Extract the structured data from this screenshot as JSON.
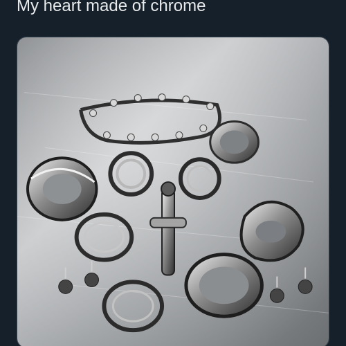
{
  "post": {
    "text": "My heart made of chrome"
  },
  "photo": {
    "subject": "chrome-jewelry-collection",
    "surface": "brushed-steel"
  },
  "colors": {
    "background": "#15202b",
    "text": "#e7e9ea",
    "border": "#38444d",
    "metal_light": "#d9d9d9",
    "metal_mid": "#9a9a9a",
    "metal_dark": "#3e3e3e"
  }
}
